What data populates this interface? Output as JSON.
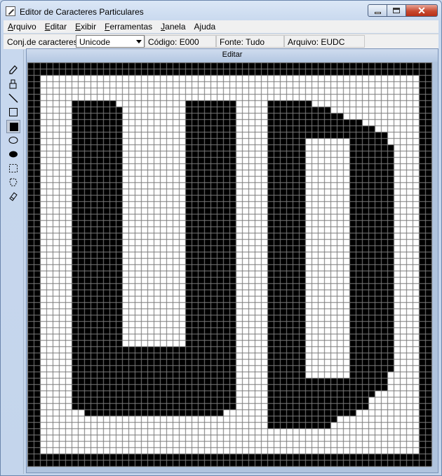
{
  "window": {
    "title": "Editor de Caracteres Particulares",
    "buttons": {
      "minimize": "minimize-icon",
      "maximize": "maximize-icon",
      "close": "✕"
    }
  },
  "menubar": {
    "items": [
      {
        "key": "A",
        "rest": "rquivo"
      },
      {
        "key": "E",
        "rest": "ditar"
      },
      {
        "key": "E",
        "rest": "xibir"
      },
      {
        "key": "F",
        "rest": "erramentas"
      },
      {
        "key": "J",
        "rest": "anela"
      },
      {
        "key": "A",
        "rest": "juda"
      }
    ]
  },
  "infobar": {
    "charset_label": "Conj.de caracteres:",
    "charset_value": "Unicode",
    "code": "Código: E000",
    "font": "Fonte: Tudo",
    "file": "Arquivo: EUDC"
  },
  "toolbox": {
    "tools": [
      "pencil-icon",
      "brush-icon",
      "line-icon",
      "hollow-rectangle-icon",
      "filled-rectangle-icon",
      "hollow-ellipse-icon",
      "filled-ellipse-icon",
      "rect-select-icon",
      "freeform-select-icon",
      "eraser-icon"
    ],
    "active_tool": "filled-rectangle-icon"
  },
  "editor": {
    "title": "Editar",
    "grid_size": 64,
    "colors": {
      "on": "#000000",
      "off": "#ffffff",
      "gridline": "#7a7a7a"
    }
  }
}
